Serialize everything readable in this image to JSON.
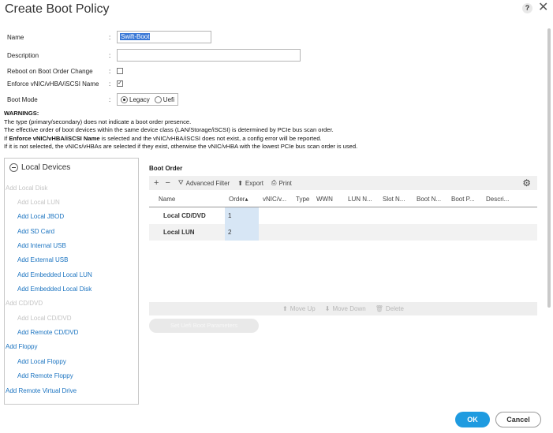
{
  "dialog": {
    "title": "Create Boot Policy",
    "help": "?",
    "close": "✕"
  },
  "form": {
    "name_label": "Name",
    "name_value": "Swift-Boot",
    "description_label": "Description",
    "description_value": "",
    "reboot_label": "Reboot on Boot Order Change",
    "reboot_checked": false,
    "enforce_label": "Enforce vNIC/vHBA/iSCSI Name",
    "enforce_checked": true,
    "boot_mode_label": "Boot Mode",
    "boot_modes": [
      "Legacy",
      "Uefi"
    ],
    "boot_mode_selected": "Legacy"
  },
  "warnings": {
    "heading": "WARNINGS:",
    "line1": "The type (primary/secondary) does not indicate a boot order presence.",
    "line2": "The effective order of boot devices within the same device class (LAN/Storage/iSCSI) is determined by PCIe bus scan order.",
    "line3_pre": "If ",
    "line3_bold": "Enforce vNIC/vHBA/iSCSI Name",
    "line3_post": " is selected and the vNIC/vHBA/iSCSI does not exist, a config error will be reported.",
    "line4": "If it is not selected, the vNICs/vHBAs are selected if they exist, otherwise the vNIC/vHBA with the lowest PCIe bus scan order is used."
  },
  "local_devices": {
    "header": "Local Devices",
    "items": [
      {
        "label": "Add Local Disk",
        "enabled": false,
        "indent": 0
      },
      {
        "label": "Add Local LUN",
        "enabled": false,
        "indent": 1
      },
      {
        "label": "Add Local JBOD",
        "enabled": true,
        "indent": 1
      },
      {
        "label": "Add SD Card",
        "enabled": true,
        "indent": 1
      },
      {
        "label": "Add Internal USB",
        "enabled": true,
        "indent": 1
      },
      {
        "label": "Add External USB",
        "enabled": true,
        "indent": 1
      },
      {
        "label": "Add Embedded Local LUN",
        "enabled": true,
        "indent": 1
      },
      {
        "label": "Add Embedded Local Disk",
        "enabled": true,
        "indent": 1
      },
      {
        "label": "Add CD/DVD",
        "enabled": false,
        "indent": 0
      },
      {
        "label": "Add Local CD/DVD",
        "enabled": false,
        "indent": 1
      },
      {
        "label": "Add Remote CD/DVD",
        "enabled": true,
        "indent": 1
      },
      {
        "label": "Add Floppy",
        "enabled": true,
        "indent": 0
      },
      {
        "label": "Add Local Floppy",
        "enabled": true,
        "indent": 1
      },
      {
        "label": "Add Remote Floppy",
        "enabled": true,
        "indent": 1
      },
      {
        "label": "Add Remote Virtual Drive",
        "enabled": true,
        "indent": 0
      }
    ]
  },
  "boot_order": {
    "title": "Boot Order",
    "toolbar": {
      "add": "+",
      "remove": "−",
      "advanced_filter": "Advanced Filter",
      "export": "Export",
      "print": "Print"
    },
    "columns": [
      "Name",
      "Order",
      "vNIC/v...",
      "Type",
      "WWN",
      "LUN N...",
      "Slot N...",
      "Boot N...",
      "Boot P...",
      "Descri..."
    ],
    "rows": [
      {
        "name": "Local CD/DVD",
        "order": "1"
      },
      {
        "name": "Local LUN",
        "order": "2"
      }
    ],
    "actions": {
      "move_up": "Move Up",
      "move_down": "Move Down",
      "delete": "Delete"
    },
    "set_uefi_label": "Set Uefi Boot Parameters"
  },
  "footer": {
    "ok": "OK",
    "cancel": "Cancel"
  },
  "colors": {
    "accent": "#1f9be0",
    "link": "#1a73c0",
    "disabled": "#c4c4c4"
  }
}
